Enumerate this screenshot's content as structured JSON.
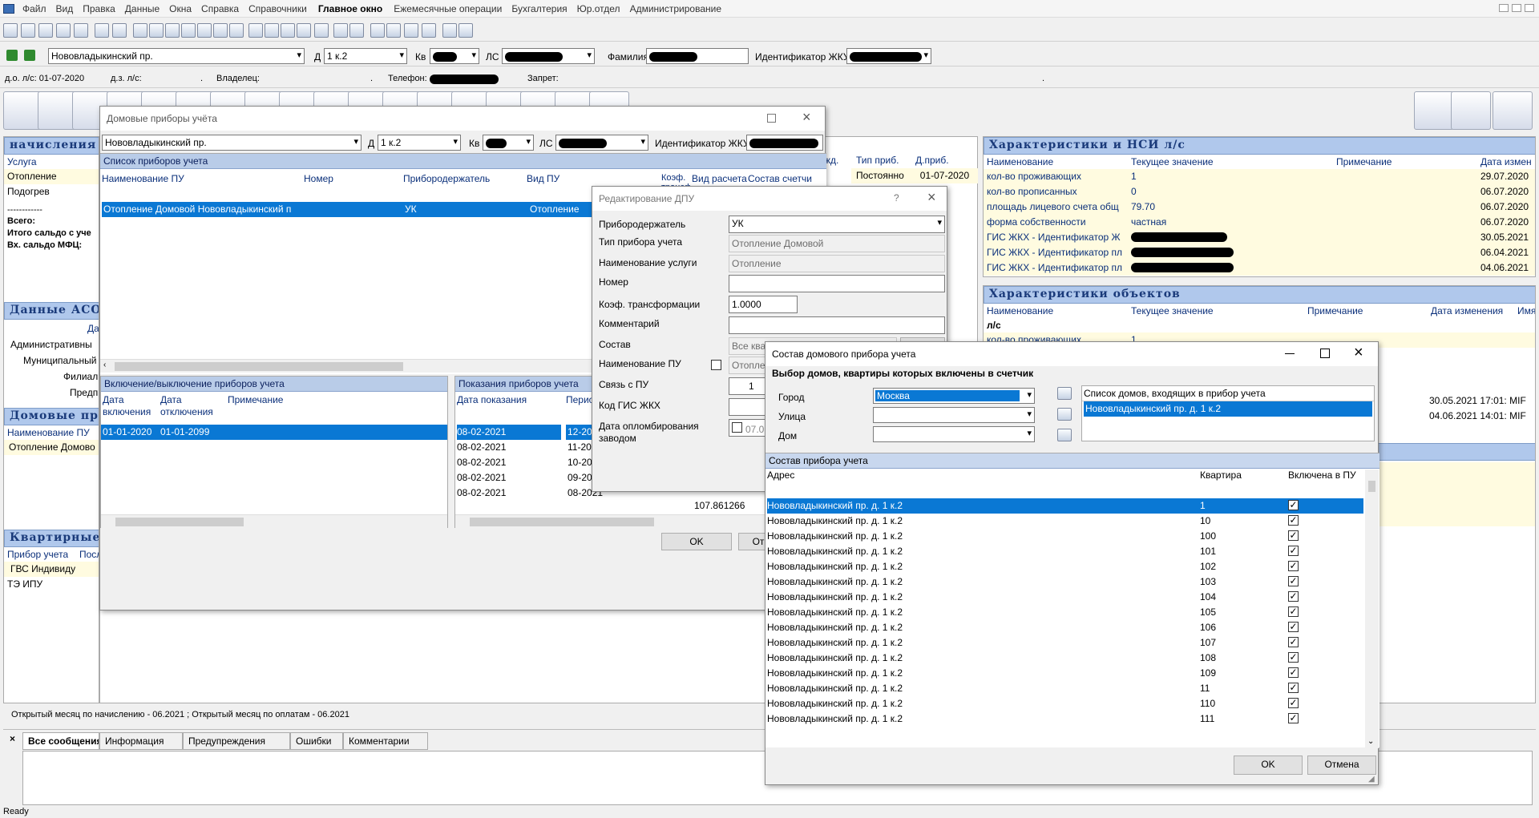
{
  "menu": [
    "Файл",
    "Вид",
    "Правка",
    "Данные",
    "Окна",
    "Справка",
    "Справочники",
    "Главное окно",
    "Ежемесячные операции",
    "Бухгалтерия",
    "Юр.отдел",
    "Администрирование"
  ],
  "filter": {
    "street": "Нововладыкинский пр.",
    "d_label": "Д",
    "house": "1 к.2",
    "kv_label": "Кв",
    "ls_label": "ЛС",
    "fam_label": "Фамилия",
    "id_label": "Идентификатор ЖКУ"
  },
  "info": {
    "do": "д.о. л/с: 01-07-2020",
    "dz": "д.з. л/с:",
    "owner": "Владелец:",
    "phone": "Телефон:",
    "ban": "Запрет:"
  },
  "left": {
    "nach": "начисления",
    "col_service": "Услуга",
    "rows": [
      "Отопление",
      "Подогрев",
      "------------",
      "Всего:",
      "Итого сальдо с уче",
      "Вх. сальдо МФЦ:"
    ],
    "asotu": "Данные АСОТ",
    "asotu_col": "Да",
    "asotu_rows": [
      "Административны",
      "Муниципальный",
      "Филиал",
      "Предп"
    ],
    "dom": "Домовые при",
    "dom_col": "Наименование ПУ",
    "dom_row": "Отопление Домово",
    "kv": "Квартирные",
    "kv_col1": "Прибор учета",
    "kv_col2": "Посл",
    "kv_rows": [
      "ГВС Индивиду",
      "ТЭ ИПУ"
    ]
  },
  "midback": {
    "col_dzh": "жд.",
    "col_tip": "Тип приб.",
    "col_dp": "Д.приб.",
    "r_tip": "Постоянно",
    "r_dp": "01-07-2020"
  },
  "right1": {
    "title": "Характеристики и НСИ л/с",
    "cols": [
      "Наименование",
      "Текущее значение",
      "Примечание",
      "Дата измен"
    ],
    "rows": [
      [
        "кол-во проживающих",
        "1",
        "29.07.2020"
      ],
      [
        "кол-во прописанных",
        "0",
        "06.07.2020"
      ],
      [
        "площадь лицевого счета общ",
        "79.70",
        "06.07.2020"
      ],
      [
        "форма собственности",
        "частная",
        "06.07.2020"
      ],
      [
        "ГИС ЖКХ - Идентификатор Ж",
        "",
        "30.05.2021"
      ],
      [
        "ГИС ЖКХ - Идентификатор пл",
        "",
        "06.04.2021"
      ],
      [
        "ГИС ЖКХ - Идентификатор пл",
        "",
        "04.06.2021"
      ]
    ]
  },
  "right2": {
    "title": "Характеристики объектов",
    "cols": [
      "Наименование",
      "Текущее значение",
      "Примечание",
      "Дата изменения",
      "Имя"
    ],
    "group": "л/с",
    "row1": [
      "кол-во проживающих",
      "1"
    ],
    "dates": [
      [
        "30.05.2021 17:01:",
        "MIF"
      ],
      [
        "04.06.2021 14:01:",
        "MIF"
      ]
    ]
  },
  "status": {
    "month": "Открытый месяц по начислению - 06.2021 ; Открытый месяц по оплатам - 06.2021",
    "ready": "Ready"
  },
  "tabs": [
    "Все сообщения",
    "Информация",
    "Предупреждения",
    "Ошибки",
    "Комментарии"
  ],
  "dpu": {
    "title": "Домовые приборы учёта",
    "street": "Нововладыкинский пр.",
    "d_label": "Д",
    "house": "1 к.2",
    "kv_label": "Кв",
    "ls_label": "ЛС",
    "id_label": "Идентификатор ЖКУ",
    "list_title": "Список приборов учета",
    "cols": [
      "Наименование ПУ",
      "Номер",
      "Прибородержатель",
      "Вид ПУ",
      "Коэф. трансф",
      "Вид расчета",
      "Состав счетчи"
    ],
    "row": [
      "Отопление Домовой Нововладыкинский п",
      "",
      "УК",
      "Отопление"
    ],
    "incl_title": "Включение/выключение приборов учета",
    "incl_cols": [
      "Дата включения",
      "Дата отключения",
      "Примечание"
    ],
    "incl_row": [
      "01-01-2020",
      "01-01-2099",
      ""
    ],
    "read_title": "Показания приборов учета",
    "read_cols": [
      "Дата показания",
      "Перио"
    ],
    "read_rows": [
      [
        "08-02-2021",
        "12-2021"
      ],
      [
        "08-02-2021",
        "11-2021"
      ],
      [
        "08-02-2021",
        "10-2021"
      ],
      [
        "08-02-2021",
        "09-2021"
      ],
      [
        "08-02-2021",
        "08-2021"
      ]
    ],
    "read_val": "107.861266",
    "ok": "OK",
    "cancel": "От"
  },
  "edit": {
    "title": "Редактирование ДПУ",
    "help": "?",
    "labels": [
      "Прибородержатель",
      "Тип прибора учета",
      "Наименование услуги",
      "Номер",
      "Коэф. трансформации",
      "Комментарий",
      "Состав",
      "Наименование ПУ",
      "Связь с ПУ",
      "Код ГИС ЖКХ",
      "Дата опломбирования заводом"
    ],
    "holder": "УК",
    "type": "Отопление Домовой",
    "service": "Отопление",
    "coef": "1.0000",
    "sostav": "Все квартиры",
    "name_pu": "Отопле",
    "link": "1",
    "seal": "07.06"
  },
  "sostav": {
    "title": "Состав домового прибора учета",
    "subtitle": "Выбор домов, квартиры которых включены в счетчик",
    "city_label": "Город",
    "city": "Москва",
    "street_label": "Улица",
    "house_label": "Дом",
    "list_title": "Список домов, входящих в прибор учета",
    "list_item": "Нововладыкинский пр. д. 1 к.2",
    "grid_title": "Состав прибора учета",
    "cols": [
      "Адрес",
      "Квартира",
      "Включена в ПУ"
    ],
    "addr": "Нововладыкинский пр. д. 1 к.2",
    "flats": [
      "1",
      "10",
      "100",
      "101",
      "102",
      "103",
      "104",
      "105",
      "106",
      "107",
      "108",
      "109",
      "11",
      "110",
      "111"
    ],
    "ok": "OK",
    "cancel": "Отмена"
  }
}
